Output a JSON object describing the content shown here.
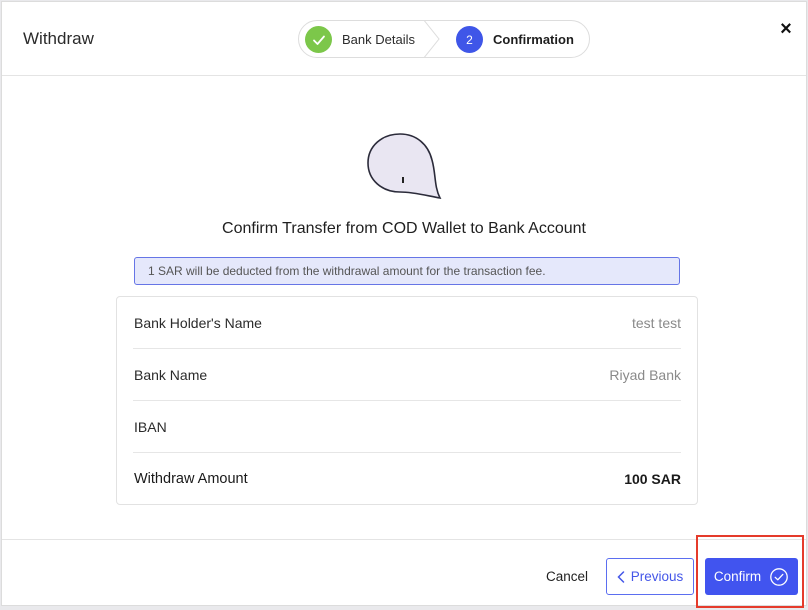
{
  "modal": {
    "title": "Withdraw",
    "close_icon": "×"
  },
  "stepper": {
    "steps": [
      {
        "label": "Bank Details",
        "state": "completed",
        "marker": "check-icon"
      },
      {
        "label": "Confirmation",
        "state": "active",
        "number": "2"
      }
    ]
  },
  "body": {
    "illustration": "wallet-drop-icon",
    "heading": "Confirm Transfer from COD Wallet to Bank Account",
    "fee_note": "1 SAR will be deducted from the withdrawal amount for the transaction fee.",
    "details": [
      {
        "label": "Bank Holder's Name",
        "value": "test test"
      },
      {
        "label": "Bank Name",
        "value": "Riyad Bank"
      },
      {
        "label": "IBAN",
        "value": ""
      },
      {
        "label": "Withdraw Amount",
        "value": "100 SAR"
      }
    ]
  },
  "footer": {
    "cancel_label": "Cancel",
    "previous_label": "Previous",
    "confirm_label": "Confirm"
  },
  "colors": {
    "primary": "#4154ef",
    "success": "#7cc74a",
    "highlight": "#e53b2b"
  }
}
